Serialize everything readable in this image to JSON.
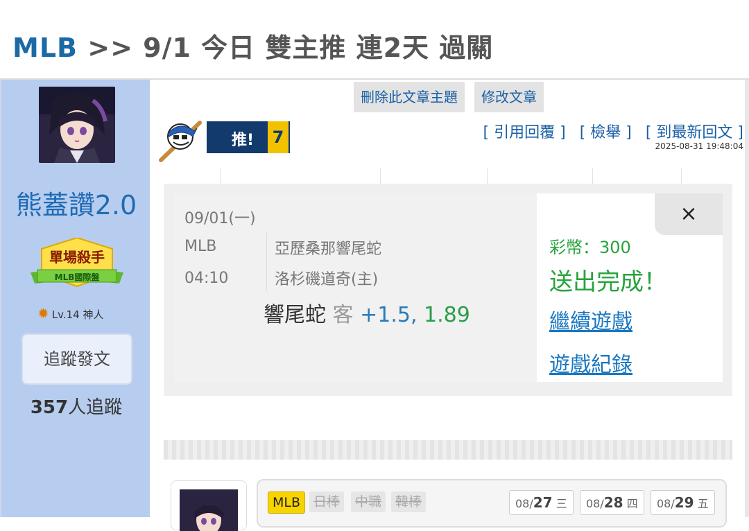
{
  "header": {
    "league": "MLB",
    "rest": ">> 9/1 今日 雙主推 連2天 過關"
  },
  "sidebar": {
    "username": "熊蓋讚2.0",
    "badge_title": "單場殺手",
    "badge_sub": "MLB國際盤",
    "level": "Lv.14 神人",
    "follow_button": "追蹤發文",
    "followers_count": "357",
    "followers_suffix": "人追蹤"
  },
  "toolbar": {
    "delete_topic": "刪除此文章主題",
    "edit_post": "修改文章"
  },
  "push": {
    "label": "推!",
    "count": "7"
  },
  "post_links": {
    "quote": "[ 引用回覆 ]",
    "report": "[ 檢舉 ]",
    "latest": "[ 到最新回文 ]"
  },
  "post_date": "2025-08-31 19:48:04",
  "bet_card": {
    "date": "09/01(一)",
    "league": "MLB",
    "time": "04:10",
    "team_away": "亞歷桑那響尾蛇",
    "team_home": "洛杉磯道奇(主)",
    "pick_team": "響尾蛇",
    "pick_side": "客",
    "pick_line": "+1.5,",
    "pick_odds": "1.89",
    "coins": "彩幣：300",
    "sent": "送出完成！",
    "continue": "繼續遊戲",
    "records": "遊戲紀錄",
    "close": "×"
  },
  "league_tags": [
    "MLB",
    "日棒",
    "中職",
    "韓棒"
  ],
  "days": [
    {
      "date": "08/",
      "day": "27",
      "weekday": "三"
    },
    {
      "date": "08/",
      "day": "28",
      "weekday": "四"
    },
    {
      "date": "08/",
      "day": "29",
      "weekday": "五"
    }
  ]
}
